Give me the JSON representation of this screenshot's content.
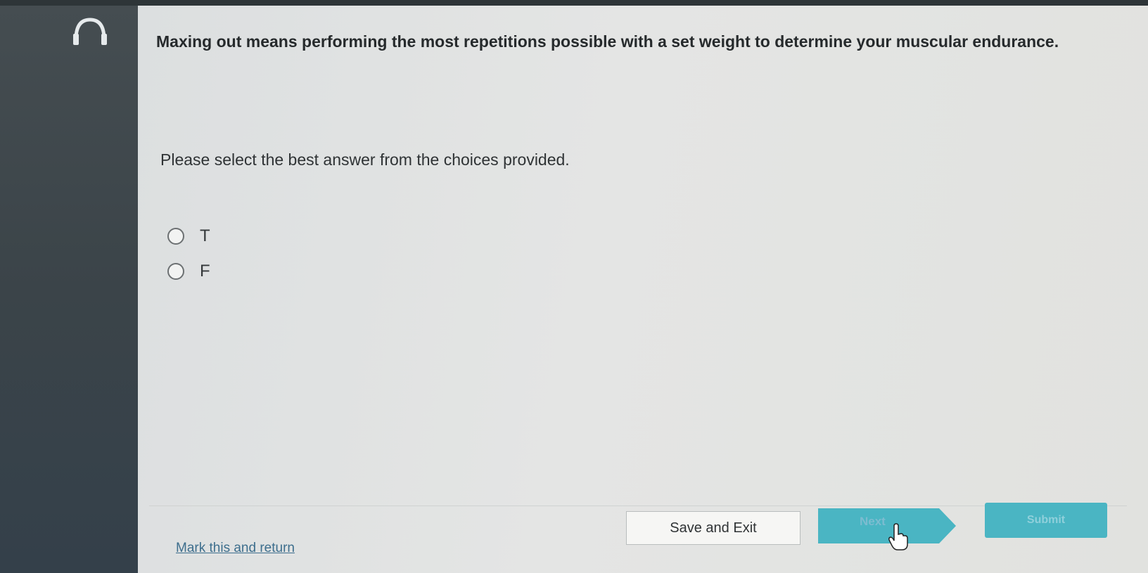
{
  "question": {
    "text": "Maxing out means performing the most repetitions possible with a set weight to determine your muscular endurance."
  },
  "instruction": "Please select the best answer from the choices provided.",
  "choices": [
    {
      "label": "T",
      "selected": false
    },
    {
      "label": "F",
      "selected": false
    }
  ],
  "footer": {
    "mark_link": "Mark this and return",
    "save_label": "Save and Exit",
    "next_label": "Next",
    "submit_label": "Submit"
  },
  "icons": {
    "audio": "headphones-icon",
    "pointer": "hand-pointer-icon"
  },
  "colors": {
    "accent": "#4ab5c3",
    "link": "#3d6e8d"
  }
}
